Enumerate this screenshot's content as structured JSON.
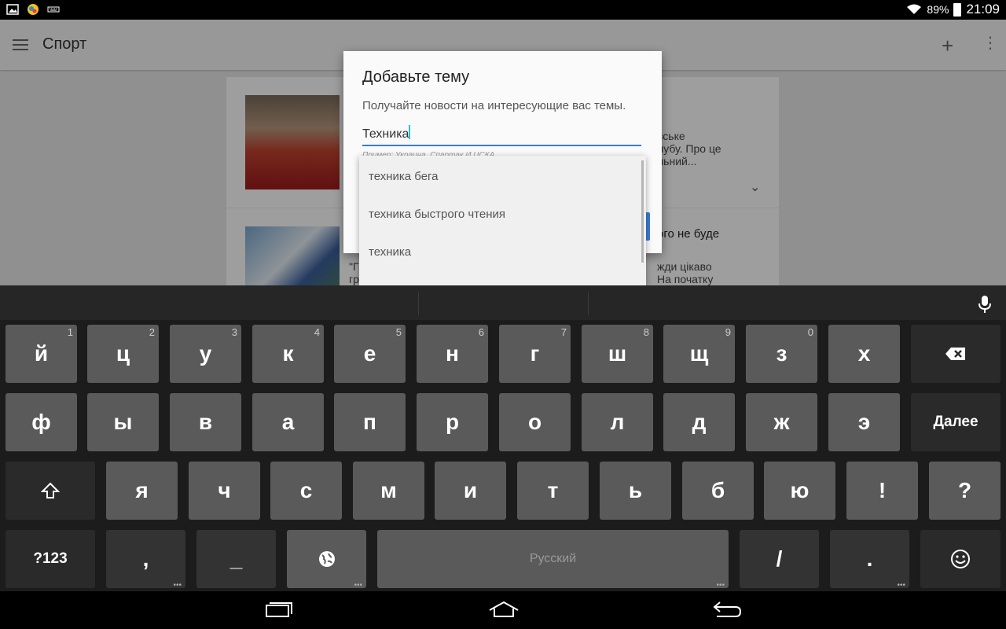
{
  "status_bar": {
    "notification_icons": [
      "gallery-icon",
      "game-icon",
      "keyboard-notification-icon"
    ],
    "battery": "89%",
    "time": "21:09"
  },
  "app": {
    "title": "Спорт",
    "toolbar_icons": [
      "menu-icon",
      "add-icon",
      "more-vert-icon"
    ],
    "cards": [
      {
        "snippet_lines": [
          "вське",
          "лубу. Про це",
          "льний..."
        ]
      },
      {
        "headline": "ого не буде",
        "snippet_quote": "\"Г",
        "snippet_lines": [
          "жди цікаво",
          "На початку"
        ],
        "snippet_left2": "гр"
      }
    ]
  },
  "dialog": {
    "title": "Добавьте тему",
    "subtitle": "Получайте новости на интересующие вас темы.",
    "input_value": "Техника",
    "hint": "Пример: Украина, Спартак И ЦСКА",
    "suggestions": [
      "техника бега",
      "техника быстрого чтения",
      "техника"
    ]
  },
  "keyboard": {
    "row1": [
      {
        "label": "й",
        "hint": "1"
      },
      {
        "label": "ц",
        "hint": "2"
      },
      {
        "label": "у",
        "hint": "3"
      },
      {
        "label": "к",
        "hint": "4"
      },
      {
        "label": "е",
        "hint": "5"
      },
      {
        "label": "н",
        "hint": "6"
      },
      {
        "label": "г",
        "hint": "7"
      },
      {
        "label": "ш",
        "hint": "8"
      },
      {
        "label": "щ",
        "hint": "9"
      },
      {
        "label": "з",
        "hint": "0"
      },
      {
        "label": "х",
        "hint": ""
      }
    ],
    "row2": [
      "ф",
      "ы",
      "в",
      "а",
      "п",
      "р",
      "о",
      "л",
      "д",
      "ж",
      "э"
    ],
    "enter_label": "Далее",
    "row3": [
      "я",
      "ч",
      "с",
      "м",
      "и",
      "т",
      "ь",
      "б",
      "ю",
      "!",
      "?"
    ],
    "symbols_label": "?123",
    "comma": ",",
    "underscore": "_",
    "space_label": "Русский",
    "slash": "/",
    "period": "."
  },
  "colors": {
    "accent": "#3a7bd5",
    "cursor": "#27c3d4",
    "key_bg": "#5a5a5a",
    "key_fn_bg": "#2a2a2a"
  }
}
